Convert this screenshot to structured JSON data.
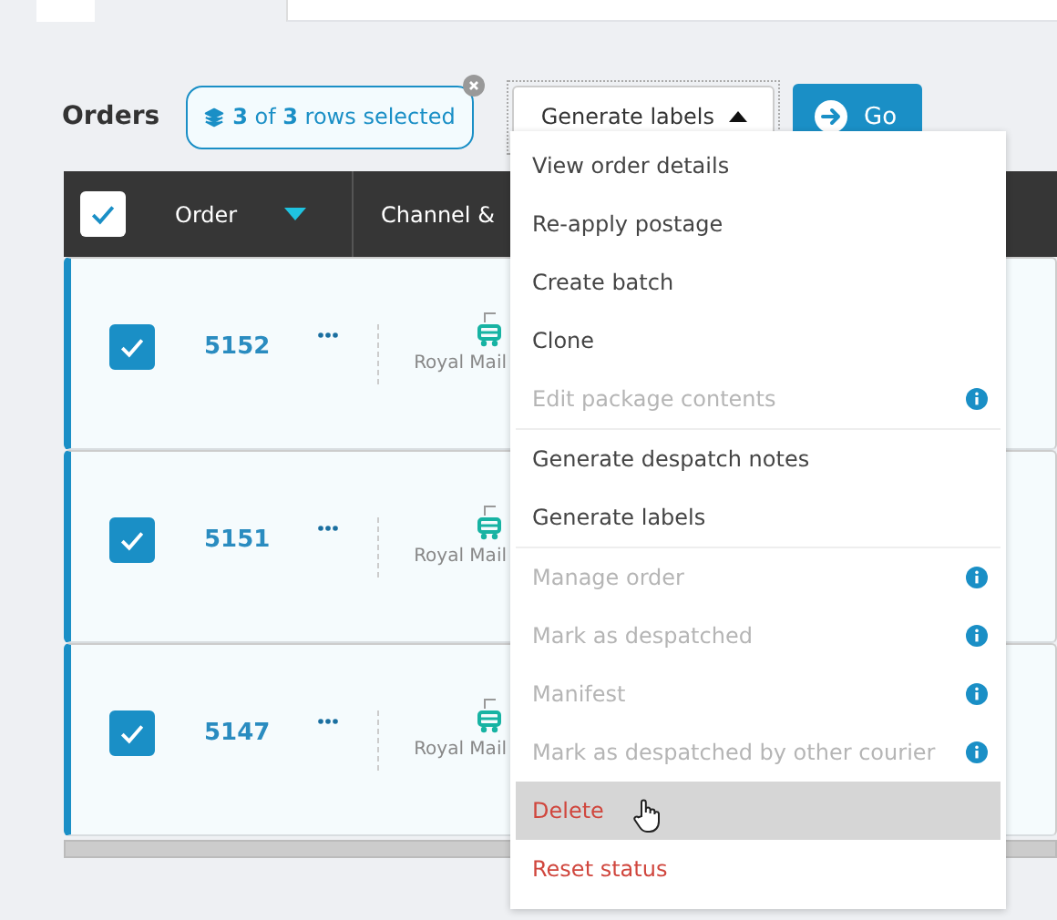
{
  "toolbar": {
    "title": "Orders",
    "selection": "**3** of **3** rows selected",
    "action_select": {
      "value": "Generate labels",
      "expanded": true
    },
    "go_button": "Go"
  },
  "table": {
    "header": {
      "checked": true,
      "columns": [
        "Order",
        "Channel &"
      ]
    },
    "rows": [
      {
        "checked": true,
        "order": "5152",
        "carrier": "Royal Mail"
      },
      {
        "checked": true,
        "order": "5151",
        "carrier": "Royal Mail"
      },
      {
        "checked": true,
        "order": "5147",
        "carrier": "Royal Mail"
      }
    ]
  },
  "menu": [
    {
      "label": "View order details",
      "kind": "normal",
      "info": false,
      "divider_after": false,
      "selected": false
    },
    {
      "label": "Re-apply postage",
      "kind": "normal",
      "info": false,
      "divider_after": false,
      "selected": false
    },
    {
      "label": "Create batch",
      "kind": "normal",
      "info": false,
      "divider_after": false,
      "selected": false
    },
    {
      "label": "Clone",
      "kind": "normal",
      "info": false,
      "divider_after": false,
      "selected": false
    },
    {
      "label": "Edit package contents",
      "kind": "disabled",
      "info": true,
      "divider_after": true,
      "selected": false
    },
    {
      "label": "Generate despatch notes",
      "kind": "normal",
      "info": false,
      "divider_after": false,
      "selected": false
    },
    {
      "label": "Generate labels",
      "kind": "normal",
      "info": false,
      "divider_after": true,
      "selected": false
    },
    {
      "label": "Manage order",
      "kind": "disabled",
      "info": true,
      "divider_after": false,
      "selected": false
    },
    {
      "label": "Mark as despatched",
      "kind": "disabled",
      "info": true,
      "divider_after": false,
      "selected": false
    },
    {
      "label": "Manifest",
      "kind": "disabled",
      "info": true,
      "divider_after": false,
      "selected": false
    },
    {
      "label": "Mark as despatched by other courier",
      "kind": "disabled",
      "info": true,
      "divider_after": false,
      "selected": false
    },
    {
      "label": "Delete",
      "kind": "danger",
      "info": false,
      "divider_after": false,
      "selected": true
    },
    {
      "label": "Reset status",
      "kind": "danger",
      "info": false,
      "divider_after": false,
      "selected": false
    }
  ]
}
